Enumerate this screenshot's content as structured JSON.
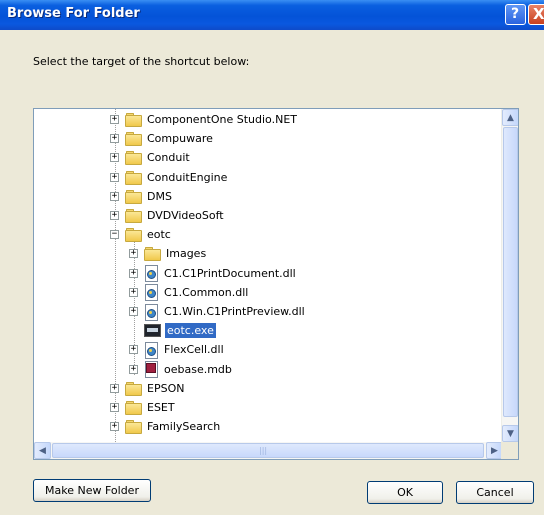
{
  "window": {
    "title": "Browse For Folder"
  },
  "titlebar_buttons": {
    "help": "?",
    "close": "X"
  },
  "instruction": "Select the target of the shortcut below:",
  "tree": {
    "items": [
      {
        "label": "ComponentOne Studio.NET",
        "icon": "folder-icon",
        "expander": "+"
      },
      {
        "label": "Compuware",
        "icon": "folder-icon",
        "expander": "+"
      },
      {
        "label": "Conduit",
        "icon": "folder-icon",
        "expander": "+"
      },
      {
        "label": "ConduitEngine",
        "icon": "folder-icon",
        "expander": "+"
      },
      {
        "label": "DMS",
        "icon": "folder-icon",
        "expander": "+"
      },
      {
        "label": "DVDVideoSoft",
        "icon": "folder-icon",
        "expander": "+"
      },
      {
        "label": "eotc",
        "icon": "folder-icon",
        "expander": "−"
      },
      {
        "label": "Images",
        "icon": "folder-icon",
        "expander": "+"
      },
      {
        "label": "C1.C1PrintDocument.dll",
        "icon": "dll-file-icon",
        "expander": "+"
      },
      {
        "label": "C1.Common.dll",
        "icon": "dll-file-icon",
        "expander": "+"
      },
      {
        "label": "C1.Win.C1PrintPreview.dll",
        "icon": "dll-file-icon",
        "expander": "+"
      },
      {
        "label": "eotc.exe",
        "icon": "exe-file-icon",
        "expander": "",
        "selected": true
      },
      {
        "label": "FlexCell.dll",
        "icon": "dll-file-icon",
        "expander": "+"
      },
      {
        "label": "oebase.mdb",
        "icon": "mdb-file-icon",
        "expander": "+"
      },
      {
        "label": "EPSON",
        "icon": "folder-icon",
        "expander": "+"
      },
      {
        "label": "ESET",
        "icon": "folder-icon",
        "expander": "+"
      },
      {
        "label": "FamilySearch",
        "icon": "folder-icon",
        "expander": "+"
      }
    ]
  },
  "scrollbar": {
    "up_arrow": "▲",
    "down_arrow": "▼",
    "left_arrow": "◀",
    "right_arrow": "▶",
    "grip": "|||"
  },
  "buttons": {
    "make_new_folder": "Make New Folder",
    "ok": "OK",
    "cancel": "Cancel"
  },
  "colors": {
    "titlebar": "#0453d8",
    "selection": "#316ac5",
    "dialog_bg": "#ece9d8"
  }
}
